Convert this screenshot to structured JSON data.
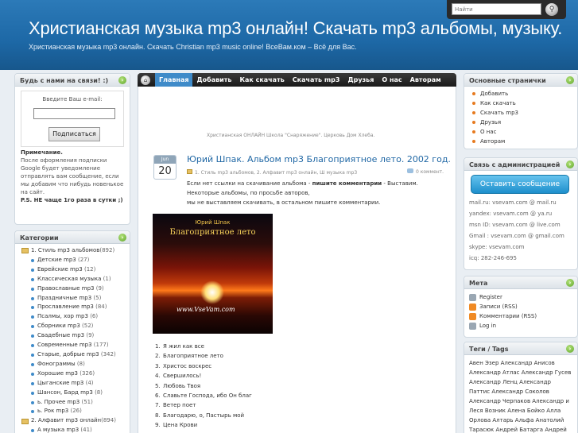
{
  "header": {
    "title": "Христианская музыка mp3 онлайн! Скачать mp3 альбомы, музыку.",
    "description": "Христианская музыка mp3 онлайн. Скачать Christian mp3 music online! ВсеВам.ком – Всё для Вас."
  },
  "search": {
    "placeholder": "Найти"
  },
  "nav": {
    "items": [
      "Главная",
      "Добавить",
      "Как скачать",
      "Скачать mp3",
      "Друзья",
      "О нас",
      "Авторам"
    ]
  },
  "subscribe": {
    "heading": "Будь с нами на связи! :)",
    "email_label": "Введите Ваш e-mail:",
    "button": "Подписаться",
    "note_title": "Примечание.",
    "note_text": "После оформления подписки Google будет уведомление отправлять вам сообщение, если мы добавим что нибудь новенькое на сайт.",
    "note_bold": "P.S. НЕ чаще 1го раза в сутки ;)"
  },
  "categories": {
    "heading": "Категории",
    "items": [
      {
        "label": "1. Стиль mp3 альбомов",
        "count": "(892)",
        "top": true
      },
      {
        "label": "Детские mp3",
        "count": "(27)"
      },
      {
        "label": "Еврейские mp3",
        "count": "(12)"
      },
      {
        "label": "Классическая музыка",
        "count": "(1)"
      },
      {
        "label": "Православные mp3",
        "count": "(9)"
      },
      {
        "label": "Праздничные mp3",
        "count": "(5)"
      },
      {
        "label": "Прославление mp3",
        "count": "(84)"
      },
      {
        "label": "Псалмы, хор mp3",
        "count": "(6)"
      },
      {
        "label": "Сборники mp3",
        "count": "(52)"
      },
      {
        "label": "Свадебные mp3",
        "count": "(9)"
      },
      {
        "label": "Современные mp3",
        "count": "(177)"
      },
      {
        "label": "Старые, добрые mp3",
        "count": "(342)"
      },
      {
        "label": "Фонограммы",
        "count": "(8)"
      },
      {
        "label": "Хорошие mp3",
        "count": "(326)"
      },
      {
        "label": "Цыганские mp3",
        "count": "(4)"
      },
      {
        "label": "Шансон, Бард mp3",
        "count": "(8)"
      },
      {
        "label": "ь. Прочее mp3",
        "count": "(51)"
      },
      {
        "label": "ь. Рок mp3",
        "count": "(26)"
      },
      {
        "label": "2. Алфавит mp3 онлайн",
        "count": "(894)",
        "top": true
      },
      {
        "label": "А музыка mp3",
        "count": "(41)"
      }
    ]
  },
  "post": {
    "school": "Христианская ОНЛАЙН Школа \"Снаряжение\". Церковь Дом Хлеба.",
    "month": "Jun",
    "day": "20",
    "title": "Юрий Шпак. Альбом mp3 Благоприятное лето. 2002 год.",
    "meta": "1. Стиль mp3 альбомов, 2. Алфавит mp3 онлайн, Ш музыка mp3",
    "comments": "0 коммент.",
    "text1": "Если нет ссылки на скачивание альбома - ",
    "text1_bold": "пишите комментарии",
    "text1_end": " - Выставим. Некоторые альбомы, по просьбе авторов,",
    "text2": "мы не выставляем скачивать, в остальном пишите комментарии.",
    "cover_author": "Юрий Шпак",
    "cover_title": "Благоприятное лето",
    "cover_url": "www.VseVam.com",
    "tracks": [
      "Я жил как все",
      "Благоприятное лето",
      "Христос воскрес",
      "Свершилось!",
      "Любовь Твоя",
      "Славьте Господа, ибо Он благ",
      "Ветер поет",
      "Благодарю, о, Пастырь мой",
      "Цена Крови"
    ]
  },
  "pages": {
    "heading": "Основные странички",
    "items": [
      "Добавить",
      "Как скачать",
      "Скачать mp3",
      "Друзья",
      "О нас",
      "Авторам"
    ]
  },
  "contact": {
    "heading": "Связь с администрацией",
    "button": "Оставить сообщение",
    "lines": [
      "mail.ru: vsevam.com @ mail.ru",
      "yandex: vsevam.com @ ya.ru",
      "msn ID: vsevam.com @ live.com",
      "Gmail : vsevam.com @ gmail.com",
      "skype: vsevam.com",
      "icq: 282-246-695"
    ]
  },
  "meta": {
    "heading": "Мета",
    "items": [
      "Register",
      "Записи (RSS)",
      "Комментарии (RSS)",
      "Log in"
    ]
  },
  "tags": {
    "heading": "Теги / Tags",
    "text": "Авен Эзер Александр Анисов Александр Атлас Александр Гусев Александр Ленц Александр Паттис Александр Соколов Александр Черпаков Александр и Леся Возник Алена Бойко Алла Орлова Алтарь Альфа Анатолий Тарасюк Андрей Батарга Андрей Лукашин Анжелика"
  }
}
